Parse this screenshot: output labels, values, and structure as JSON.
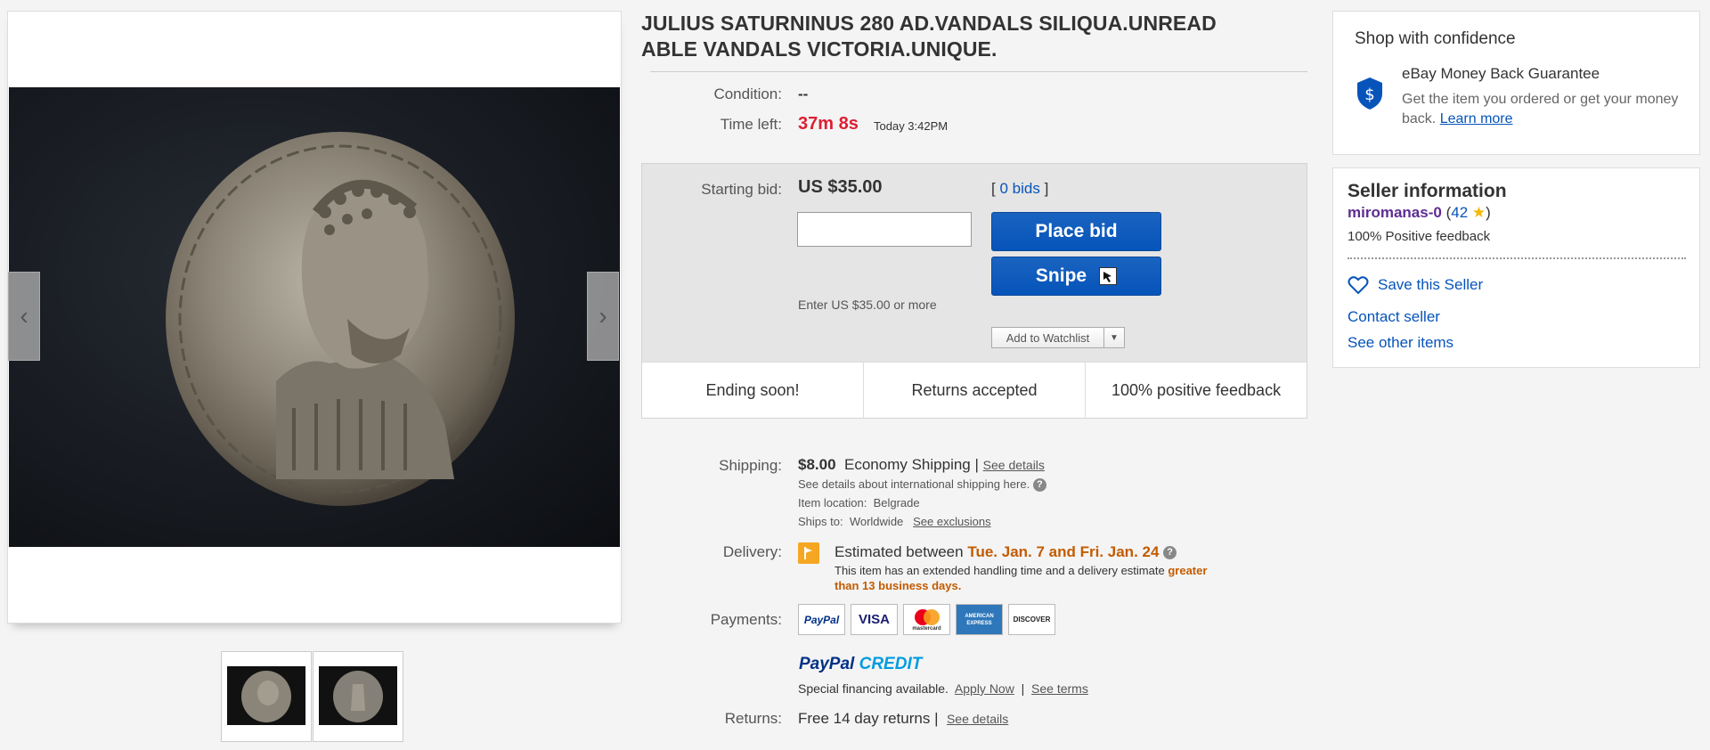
{
  "title": "JULIUS SATURNINUS 280 AD.VANDALS SILIQUA.UNREADABLE VANDALS VICTORIA.UNIQUE.",
  "title_lines": [
    "JULIUS SATURNINUS 280 AD.VANDALS SILIQUA.UNREAD",
    "ABLE VANDALS VICTORIA.UNIQUE."
  ],
  "gallery": {
    "prev_glyph": "‹",
    "next_glyph": "›",
    "thumbnails": [
      {
        "name": "thumbnail-1"
      },
      {
        "name": "thumbnail-2"
      }
    ]
  },
  "details": {
    "condition_label": "Condition:",
    "condition_value": "--",
    "time_left_label": "Time left:",
    "time_left_value": "37m 8s",
    "time_left_end": "Today 3:42PM"
  },
  "bid": {
    "starting_bid_label": "Starting bid:",
    "starting_bid_value": "US $35.00",
    "bids_open": "[",
    "bids_link": "0 bids",
    "bids_close": "]",
    "input_value": "",
    "place_bid_label": "Place bid",
    "snipe_label": "Snipe",
    "enter_hint": "Enter US $35.00 or more",
    "watchlist_label": "Add to Watchlist",
    "watchlist_dropdown": "▼"
  },
  "promos": [
    "Ending soon!",
    "Returns accepted",
    "100% positive feedback"
  ],
  "shipping": {
    "label": "Shipping:",
    "cost": "$8.00",
    "method": "Economy Shipping |",
    "see_details": "See details",
    "intl_note": "See details about international shipping here.",
    "location_label": "Item location:",
    "location_value": "Belgrade",
    "ships_to_label": "Ships to:",
    "ships_to_value": "Worldwide",
    "see_exclusions": "See exclusions"
  },
  "delivery": {
    "label": "Delivery:",
    "estimated_prefix": "Estimated between",
    "estimated_dates": "Tue. Jan. 7 and Fri. Jan. 24",
    "note_prefix": "This item has an extended handling time and a delivery estimate",
    "note_highlight_1": "greater",
    "note_highlight_2": "than 13 business days."
  },
  "payments": {
    "label": "Payments:",
    "logos": [
      "PayPal",
      "VISA",
      "mastercard",
      "AMERICAN EXPRESS",
      "DISCOVER"
    ],
    "paypal_credit_1": "PayPal",
    "paypal_credit_2": "CREDIT",
    "financing": "Special financing available.",
    "apply_now": "Apply Now",
    "separator": "|",
    "see_terms": "See terms"
  },
  "returns": {
    "label": "Returns:",
    "value": "Free 14 day returns |",
    "see_details": "See details"
  },
  "confidence": {
    "heading": "Shop with confidence",
    "guarantee_title": "eBay Money Back Guarantee",
    "guarantee_text": "Get the item you ordered or get your money back.",
    "learn_more": "Learn more"
  },
  "seller": {
    "heading": "Seller information",
    "username": "miromanas-0",
    "score_open": "(",
    "score": "42",
    "score_close": ")",
    "feedback": "100% Positive feedback",
    "save_seller": "Save this Seller",
    "contact": "Contact seller",
    "other_items": "See other items"
  },
  "colors": {
    "accent_blue": "#0654ba",
    "time_red": "#dd1e31",
    "delivery_orange": "#c35b00",
    "seller_purple": "#5d2d91"
  }
}
